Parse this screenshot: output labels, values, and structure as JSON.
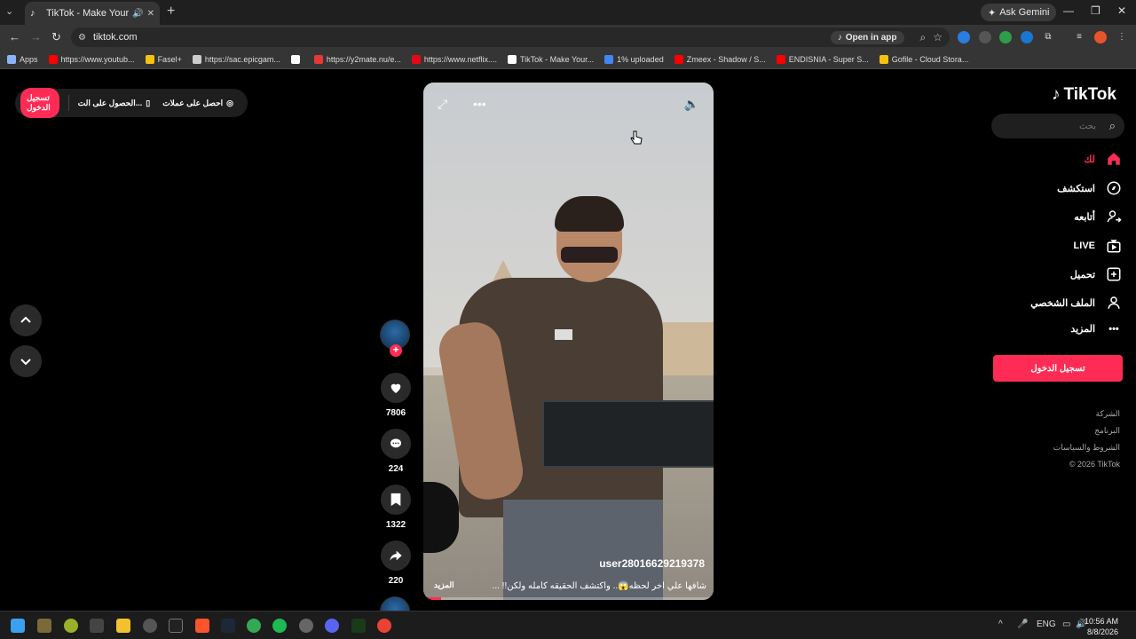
{
  "browser": {
    "tab_title": "TikTok - Make Your Day",
    "url": "tiktok.com",
    "open_in_app": "Open in app",
    "ask_gemini": "Ask Gemini",
    "bookmarks": [
      {
        "label": "Apps",
        "color": "#8ab4f8"
      },
      {
        "label": "https://www.youtub...",
        "color": "#ff0000"
      },
      {
        "label": "Fasel+",
        "color": "#f4c20d"
      },
      {
        "label": "https://sac.epicgam...",
        "color": "#cccccc"
      },
      {
        "label": "",
        "color": "#ffffff"
      },
      {
        "label": "https://y2mate.nu/e...",
        "color": "#e53935"
      },
      {
        "label": "https://www.netflix....",
        "color": "#e50914"
      },
      {
        "label": "TikTok - Make Your...",
        "color": "#ffffff"
      },
      {
        "label": "1% uploaded",
        "color": "#4285f4"
      },
      {
        "label": "Zmeex - Shadow / S...",
        "color": "#ff0000"
      },
      {
        "label": "ENDISNIA - Super S...",
        "color": "#ff0000"
      },
      {
        "label": "Gofile - Cloud Stora...",
        "color": "#f4c20d"
      }
    ]
  },
  "topbar": {
    "login": "تسجيل الدخول",
    "get_app": "الحصول على الت...",
    "get_coins": "احصل على عملات"
  },
  "video": {
    "username": "user28016629219378",
    "caption": "شافها علي اخر لحظه😱.. واكتشف الحقيقه كامله ولكن!! ...",
    "more": "المزيد",
    "progress_percent": 6
  },
  "actions": {
    "likes": "7806",
    "comments": "224",
    "saves": "1322",
    "shares": "220"
  },
  "sidebar": {
    "logo": "TikTok",
    "search_placeholder": "بحث",
    "nav": [
      {
        "label": "لك",
        "icon": "home-icon",
        "active": true
      },
      {
        "label": "استكشف",
        "icon": "compass-icon"
      },
      {
        "label": "أتابعه",
        "icon": "following-icon"
      },
      {
        "label": "LIVE",
        "icon": "live-icon"
      },
      {
        "label": "تحميل",
        "icon": "upload-icon"
      },
      {
        "label": "الملف الشخصي",
        "icon": "profile-icon"
      },
      {
        "label": "المزيد",
        "icon": "more-icon"
      }
    ],
    "login_button": "تسجيل الدخول",
    "footer": [
      "الشركة",
      "البرنامج",
      "الشروط والسياسات",
      "© 2026 TikTok"
    ]
  },
  "taskbar": {
    "lang": "ENG",
    "time": "10:56 AM",
    "date": "8/8/2026"
  },
  "colors": {
    "accent": "#fe2c55",
    "page_bg": "#000000"
  }
}
